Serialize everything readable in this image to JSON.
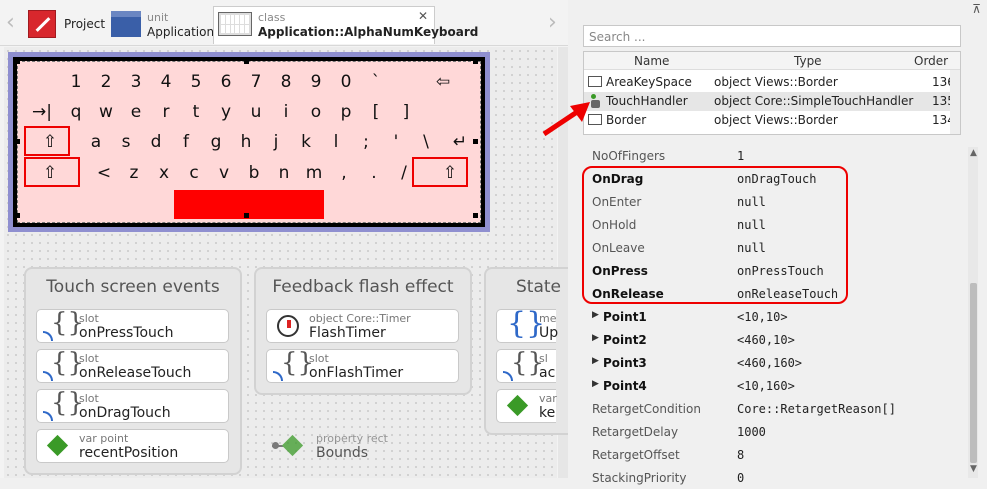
{
  "breadcrumbs": {
    "project": {
      "label": "Project"
    },
    "unit": {
      "kind": "unit",
      "label": "Application"
    },
    "class": {
      "kind": "class",
      "label": "Application::AlphaNumKeyboard",
      "close": "✕"
    }
  },
  "keyboard": {
    "rows": [
      [
        "1",
        "2",
        "3",
        "4",
        "5",
        "6",
        "7",
        "8",
        "9",
        "0",
        "`",
        "⇦"
      ],
      [
        "→|",
        "q",
        "w",
        "e",
        "r",
        "t",
        "y",
        "u",
        "i",
        "o",
        "p",
        "[",
        "]"
      ],
      [
        "⇧",
        "a",
        "s",
        "d",
        "f",
        "g",
        "h",
        "j",
        "k",
        "l",
        ";",
        "'",
        "\\",
        "↵"
      ],
      [
        "⇧",
        "<",
        "z",
        "x",
        "c",
        "v",
        "b",
        "n",
        "m",
        ",",
        ".",
        "/",
        "⇧"
      ]
    ]
  },
  "groups": [
    {
      "title": "Touch screen events"
    },
    {
      "title": "Feedback flash effect"
    },
    {
      "title": "State"
    }
  ],
  "items": {
    "press": {
      "kind": "slot",
      "name": "onPressTouch"
    },
    "release": {
      "kind": "slot",
      "name": "onReleaseTouch"
    },
    "drag": {
      "kind": "slot",
      "name": "onDragTouch"
    },
    "recent": {
      "kind": "var point",
      "name": "recentPosition"
    },
    "flashtimer": {
      "kind": "object Core::Timer",
      "name": "FlashTimer"
    },
    "flashslot": {
      "kind": "slot",
      "name": "onFlashTimer"
    },
    "bounds": {
      "kind": "property rect",
      "name": "Bounds"
    },
    "state1": {
      "kind": "me",
      "name": "Up"
    },
    "state2": {
      "kind": "sl",
      "name": "ac"
    },
    "state3": {
      "kind": "var",
      "name": "ke"
    }
  },
  "inspector": {
    "pin": "⊼",
    "search_placeholder": "Search ...",
    "columns": [
      "Name",
      "Type",
      "Order"
    ],
    "members": [
      {
        "name": "AreaKeySpace",
        "type": "object Views::Border",
        "order": "136"
      },
      {
        "name": "TouchHandler",
        "type": "object Core::SimpleTouchHandler",
        "order": "135"
      },
      {
        "name": "Border",
        "type": "object Views::Border",
        "order": "134"
      }
    ],
    "properties": [
      {
        "name": "NoOfFingers",
        "value": "1"
      },
      {
        "name": "OnDrag",
        "value": "onDragTouch"
      },
      {
        "name": "OnEnter",
        "value": "null"
      },
      {
        "name": "OnHold",
        "value": "null"
      },
      {
        "name": "OnLeave",
        "value": "null"
      },
      {
        "name": "OnPress",
        "value": "onPressTouch"
      },
      {
        "name": "OnRelease",
        "value": "onReleaseTouch"
      },
      {
        "name": "Point1",
        "value": "<10,10>"
      },
      {
        "name": "Point2",
        "value": "<460,10>"
      },
      {
        "name": "Point3",
        "value": "<460,160>"
      },
      {
        "name": "Point4",
        "value": "<10,160>"
      },
      {
        "name": "RetargetCondition",
        "value": "Core::RetargetReason[]"
      },
      {
        "name": "RetargetDelay",
        "value": "1000"
      },
      {
        "name": "RetargetOffset",
        "value": "8"
      },
      {
        "name": "StackingPriority",
        "value": "0"
      }
    ]
  },
  "colors": {
    "highlight": "#ee0000",
    "keyboard_bg": "#ffd8d8",
    "spacebar": "#ff0000",
    "slot_icon": "#2e68c8",
    "var_icon": "#3a9a27"
  }
}
